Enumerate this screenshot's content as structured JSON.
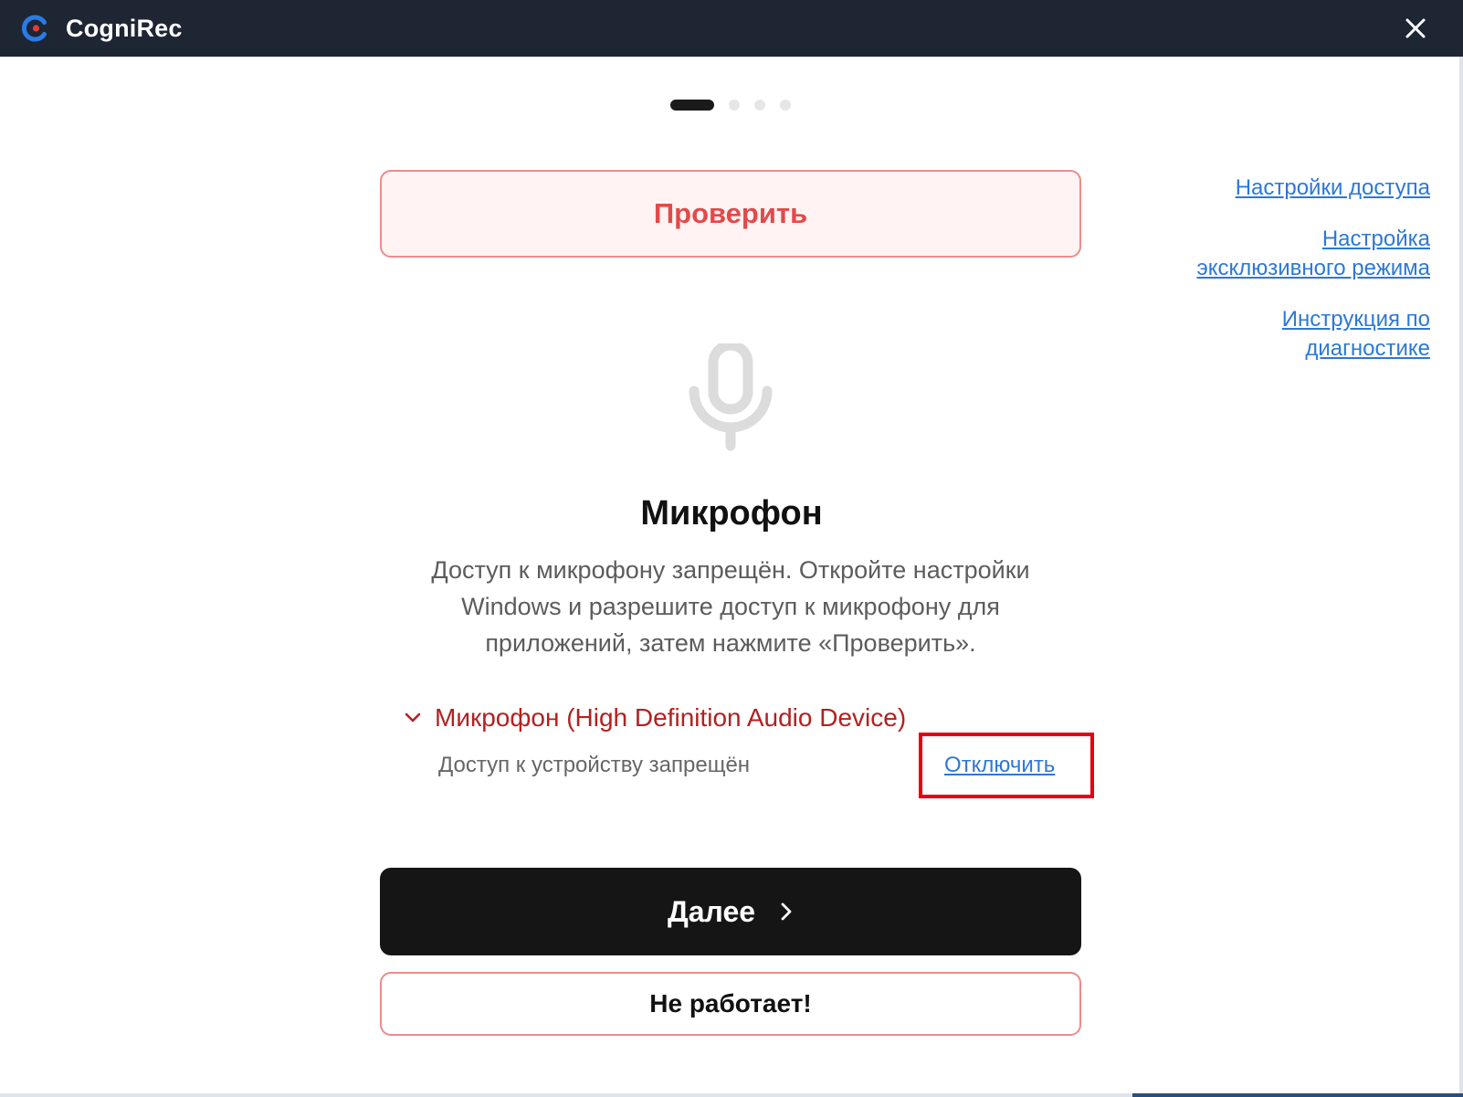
{
  "app": {
    "title": "CogniRec",
    "logo_icon": "cognirec-logo-icon",
    "close_icon": "close-icon"
  },
  "pager": {
    "total": 4,
    "current": 1
  },
  "buttons": {
    "check": "Проверить",
    "next": "Далее",
    "next_icon": "chevron-right-icon",
    "not_working": "Не работает!"
  },
  "side_links": [
    "Настройки доступа",
    "Настройка эксклюзивного режима",
    "Инструкция по диагностике"
  ],
  "section": {
    "icon": "microphone-icon",
    "title": "Микрофон",
    "description": "Доступ к микрофону запрещён. Откройте настройки Windows и разрешите доступ к микрофону для приложений, затем нажмите «Проверить»."
  },
  "device": {
    "expand_icon": "chevron-down-icon",
    "label": "Микрофон (High Definition Audio Device)",
    "status": "Доступ к устройству запрещён",
    "action": "Отключить"
  },
  "colors": {
    "titlebar": "#1e2533",
    "accent_red": "#e24a4a",
    "link_blue": "#2d78d6",
    "device_red": "#b42020",
    "highlight": "#e8000b"
  }
}
